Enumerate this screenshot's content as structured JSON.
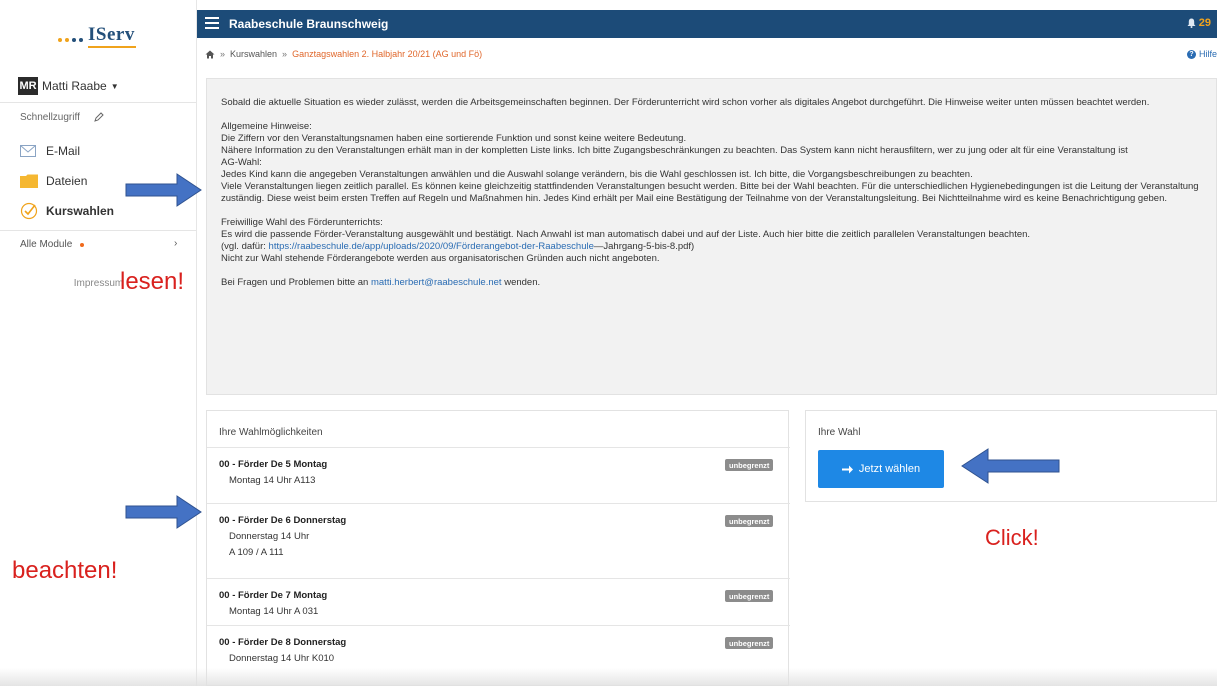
{
  "sidebar": {
    "logo_text": "IServ",
    "user": {
      "initials": "MR",
      "name": "Matti Raabe"
    },
    "quick_access_label": "Schnellzugriff",
    "items": [
      {
        "label": "E-Mail",
        "icon": "mail-icon"
      },
      {
        "label": "Dateien",
        "icon": "folder-icon"
      },
      {
        "label": "Kurswahlen",
        "icon": "check-circle-icon",
        "active": true
      }
    ],
    "all_modules_label": "Alle Module",
    "impressum": "Impressum"
  },
  "topbar": {
    "title": "Raabeschule Braunschweig",
    "notification_count": "29"
  },
  "breadcrumb": {
    "items": [
      "Kurswahlen",
      "Ganztagswahlen 2. Halbjahr 20/21 (AG und Fö)"
    ],
    "help": "Hilfe"
  },
  "info": {
    "p1": "Sobald die aktuelle Situation es wieder zulässt, werden die Arbeitsgemeinschaften beginnen. Der Förderunterricht wird schon vorher als digitales Angebot durchgeführt. Die Hinweise weiter unten müssen beachtet werden.",
    "general_title": "Allgemeine Hinweise:",
    "general_1": "Die Ziffern vor den Veranstaltungsnamen haben eine sortierende Funktion und sonst keine weitere Bedeutung.",
    "general_2": "Nähere Information zu den Veranstaltungen erhält man in der kompletten Liste links. Ich bitte Zugangsbeschränkungen zu beachten. Das System kann nicht herausfiltern, wer zu jung oder alt für eine Veranstaltung ist",
    "ag_title": "AG-Wahl:",
    "ag_1": "Jedes Kind kann die angegeben Veranstaltungen anwählen und die Auswahl solange verändern, bis die Wahl geschlossen ist. Ich bitte, die Vorgangsbeschreibungen zu beachten.",
    "ag_2": "Viele Veranstaltungen liegen zeitlich parallel. Es können keine gleichzeitig stattfindenden Veranstaltungen besucht werden. Bitte bei der Wahl beachten. Für die unterschiedlichen Hygienebedingungen ist die Leitung der Veranstaltung zuständig. Diese weist beim ersten Treffen auf Regeln und Maßnahmen hin. Jedes Kind erhält per Mail eine Bestätigung der Teilnahme von der Veranstaltungsleitung. Bei Nichtteilnahme wird es keine Benachrichtigung geben.",
    "foerder_title": "Freiwillige Wahl des Förderunterrichts:",
    "foerder_1": "Es wird die passende Förder-Veranstaltung ausgewählt und bestätigt. Nach Anwahl ist man automatisch dabei und auf der Liste. Auch hier bitte die zeitlich parallelen Veranstaltungen beachten.",
    "foerder_2_prefix": "(vgl. dafür: ",
    "foerder_2_link": "https://raabeschule.de/app/uploads/2020/09/Förderangebot-der-Raabeschule",
    "foerder_2_suffix": "—Jahrgang-5-bis-8.pdf)",
    "foerder_3": "Nicht zur Wahl stehende Förderangebote werden aus organisatorischen Gründen auch nicht angeboten.",
    "contact_prefix": "Bei Fragen und Problemen bitte an ",
    "contact_email": "matti.herbert@raabeschule.net",
    "contact_suffix": " wenden."
  },
  "choices": {
    "heading": "Ihre Wahlmöglichkeiten",
    "items": [
      {
        "title": "00 - Förder De 5 Montag",
        "line1": "Montag 14 Uhr A113",
        "line2": "",
        "badge": "unbegrenzt"
      },
      {
        "title": "00 - Förder De 6 Donnerstag",
        "line1": "Donnerstag 14 Uhr",
        "line2": "A 109 / A 111",
        "badge": "unbegrenzt"
      },
      {
        "title": "00 - Förder De 7 Montag",
        "line1": "Montag 14 Uhr A 031",
        "line2": "",
        "badge": "unbegrenzt"
      },
      {
        "title": "00 - Förder De 8 Donnerstag",
        "line1": "Donnerstag 14 Uhr K010",
        "line2": "",
        "badge": "unbegrenzt"
      }
    ]
  },
  "wahl": {
    "heading": "Ihre Wahl",
    "button_label": "Jetzt wählen"
  },
  "annotations": {
    "lesen": "lesen!",
    "beachten": "beachten!",
    "click": "Click!"
  },
  "colors": {
    "topbar": "#1c4b78",
    "accent_button": "#1e88e5",
    "annotation": "#d9211e",
    "arrow": "#4472c4",
    "breadcrumb_active": "#e0672b"
  }
}
